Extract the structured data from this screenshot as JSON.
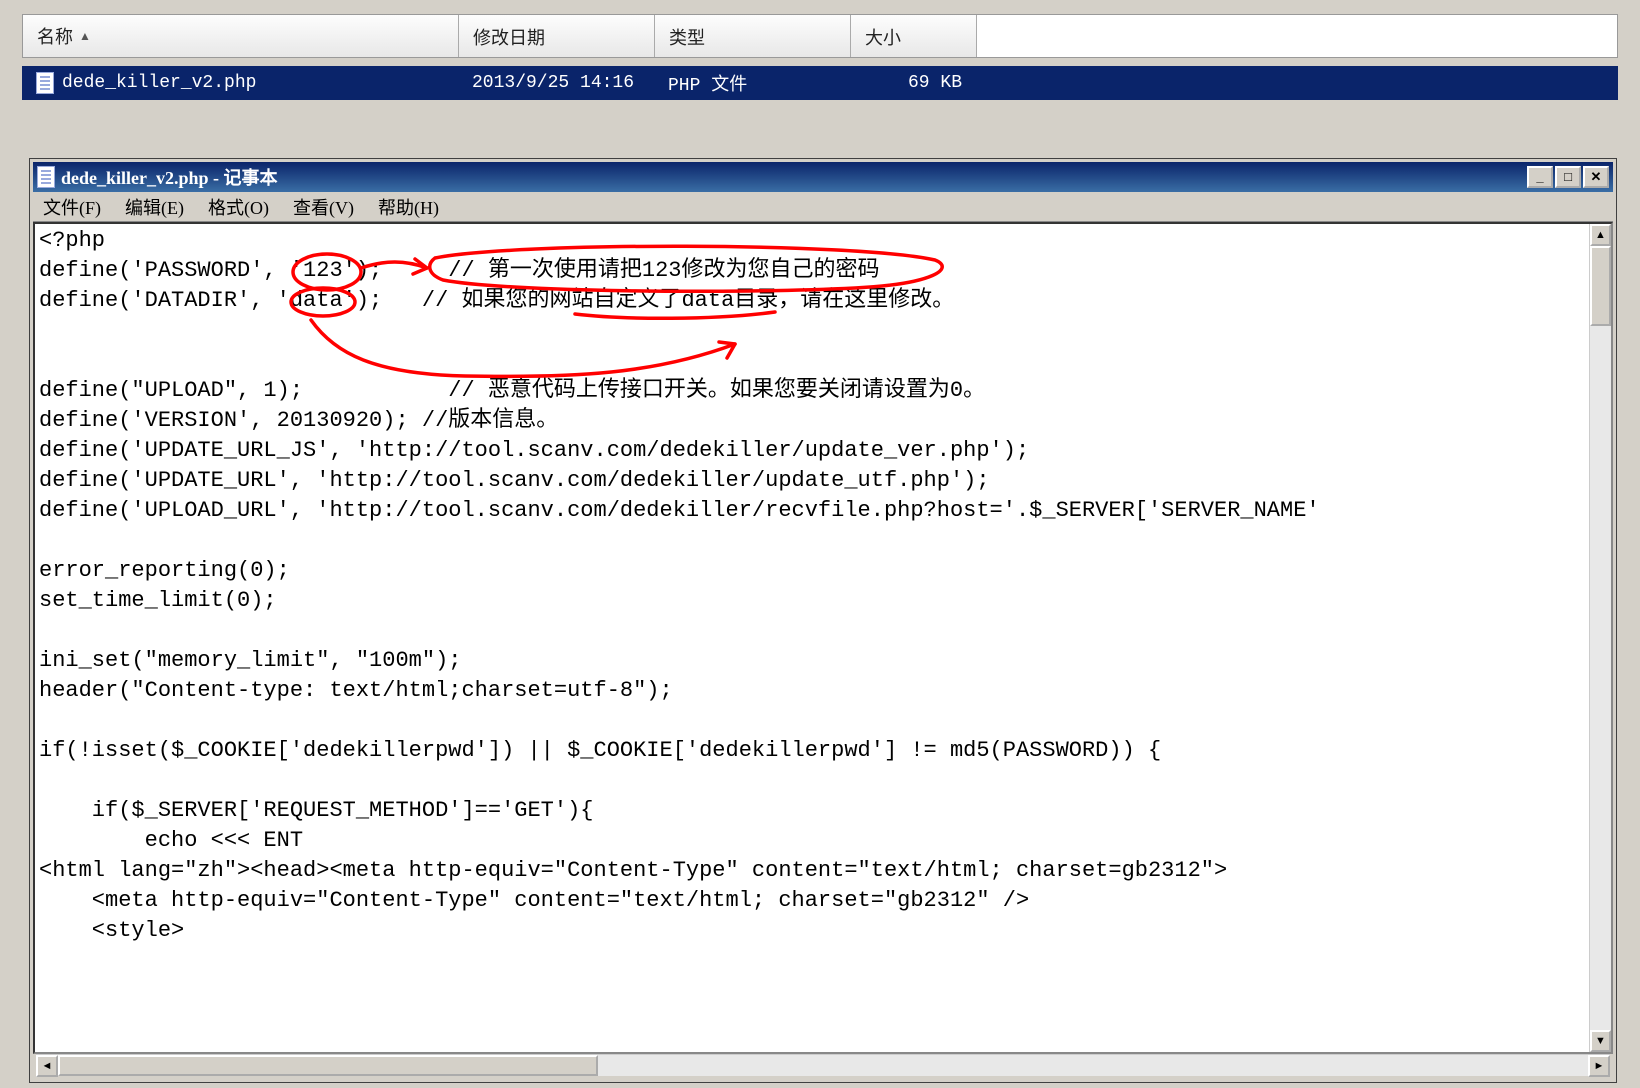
{
  "explorer": {
    "columns": {
      "name": "名称",
      "date": "修改日期",
      "type": "类型",
      "size": "大小"
    },
    "row": {
      "name": "dede_killer_v2.php",
      "date": "2013/9/25 14:16",
      "type": "PHP 文件",
      "size": "69 KB"
    }
  },
  "notepad": {
    "title": "dede_killer_v2.php - 记事本",
    "menu": {
      "file": "文件(F)",
      "edit": "编辑(E)",
      "format": "格式(O)",
      "view": "查看(V)",
      "help": "帮助(H)"
    },
    "content": "<?php\ndefine('PASSWORD', '123');     // 第一次使用请把123修改为您自己的密码\ndefine('DATADIR', 'data');   // 如果您的网站自定义了data目录，请在这里修改。\n\n\ndefine(\"UPLOAD\", 1);           // 恶意代码上传接口开关。如果您要关闭请设置为0。\ndefine('VERSION', 20130920); //版本信息。\ndefine('UPDATE_URL_JS', 'http://tool.scanv.com/dedekiller/update_ver.php');\ndefine('UPDATE_URL', 'http://tool.scanv.com/dedekiller/update_utf.php');\ndefine('UPLOAD_URL', 'http://tool.scanv.com/dedekiller/recvfile.php?host='.$_SERVER['SERVER_NAME'\n\nerror_reporting(0);\nset_time_limit(0);\n\nini_set(\"memory_limit\", \"100m\");\nheader(\"Content-type: text/html;charset=utf-8\");\n\nif(!isset($_COOKIE['dedekillerpwd']) || $_COOKIE['dedekillerpwd'] != md5(PASSWORD)) {\n\n    if($_SERVER['REQUEST_METHOD']=='GET'){\n        echo <<< ENT\n<html lang=\"zh\"><head><meta http-equiv=\"Content-Type\" content=\"text/html; charset=gb2312\">\n    <meta http-equiv=\"Content-Type\" content=\"text/html; charset=\"gb2312\" />\n    <style>"
  }
}
